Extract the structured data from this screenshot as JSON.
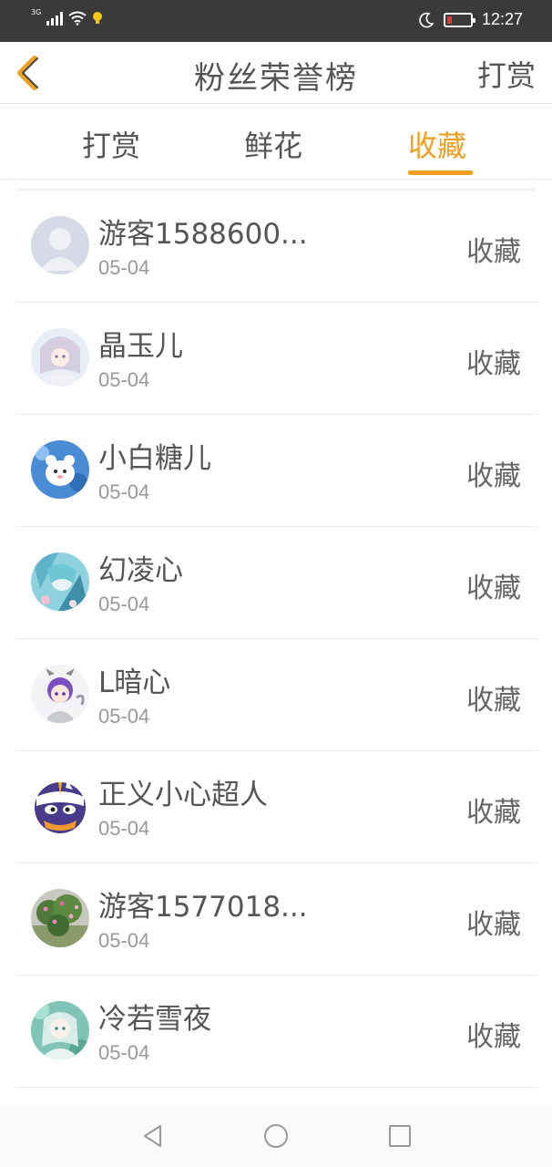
{
  "status_bar": {
    "network": "3G",
    "time": "12:27"
  },
  "header": {
    "back_icon": "chevron-left-icon",
    "title": "粉丝荣誉榜",
    "right_action": "打赏"
  },
  "tabs": [
    {
      "label": "打赏",
      "active": false
    },
    {
      "label": "鲜花",
      "active": false
    },
    {
      "label": "收藏",
      "active": true
    }
  ],
  "accent_color": "#f0a020",
  "fans": [
    {
      "name": "游客1588600...",
      "date": "05-04",
      "action": "收藏",
      "avatar": "default-avatar"
    },
    {
      "name": "晶玉儿",
      "date": "05-04",
      "action": "收藏",
      "avatar": "anime-girl-avatar"
    },
    {
      "name": "小白糖儿",
      "date": "05-04",
      "action": "收藏",
      "avatar": "white-cat-avatar"
    },
    {
      "name": "幻凌心",
      "date": "05-04",
      "action": "收藏",
      "avatar": "anime-blue-avatar"
    },
    {
      "name": "L暗心",
      "date": "05-04",
      "action": "收藏",
      "avatar": "purple-hair-chibi-avatar"
    },
    {
      "name": "正义小心超人",
      "date": "05-04",
      "action": "收藏",
      "avatar": "masked-hero-avatar"
    },
    {
      "name": "游客1577018...",
      "date": "05-04",
      "action": "收藏",
      "avatar": "flower-photo-avatar"
    },
    {
      "name": "冷若雪夜",
      "date": "05-04",
      "action": "收藏",
      "avatar": "anime-teal-avatar"
    }
  ],
  "nav_bar": {
    "back": "triangle-back-icon",
    "home": "circle-home-icon",
    "recent": "square-recent-icon"
  }
}
